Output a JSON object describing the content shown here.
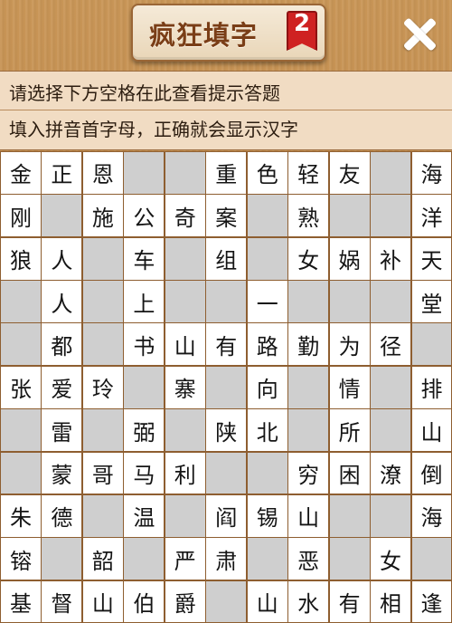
{
  "header": {
    "title": "疯狂填字",
    "badge": "2"
  },
  "hint": {
    "line1": "请选择下方空格在此查看提示答题",
    "line2": "填入拼音首字母，正确就会显示汉字"
  },
  "grid": {
    "rows": 11,
    "cols": 11,
    "cells": [
      [
        "金",
        "正",
        "恩",
        "#",
        "#",
        "重",
        "色",
        "轻",
        "友",
        "#",
        "海"
      ],
      [
        "刚",
        "#",
        "施",
        "公",
        "奇",
        "案",
        "#",
        "熟",
        "#",
        "#",
        "洋"
      ],
      [
        "狼",
        "人",
        "#",
        "车",
        "#",
        "组",
        "#",
        "女",
        "娲",
        "补",
        "天"
      ],
      [
        "#",
        "人",
        "#",
        "上",
        "#",
        "#",
        "一",
        "#",
        "#",
        "#",
        "堂"
      ],
      [
        "#",
        "都",
        "#",
        "书",
        "山",
        "有",
        "路",
        "勤",
        "为",
        "径",
        "#"
      ],
      [
        "张",
        "爱",
        "玲",
        "#",
        "寨",
        "#",
        "向",
        "#",
        "情",
        "#",
        "排"
      ],
      [
        "#",
        "雷",
        "#",
        "弼",
        "#",
        "陕",
        "北",
        "#",
        "所",
        "#",
        "山"
      ],
      [
        "#",
        "蒙",
        "哥",
        "马",
        "利",
        "#",
        "#",
        "穷",
        "困",
        "潦",
        "倒"
      ],
      [
        "朱",
        "德",
        "#",
        "温",
        "#",
        "阎",
        "锡",
        "山",
        "#",
        "#",
        "海"
      ],
      [
        "镕",
        "#",
        "韶",
        "#",
        "严",
        "肃",
        "#",
        "恶",
        "#",
        "女",
        "#"
      ],
      [
        "基",
        "督",
        "山",
        "伯",
        "爵",
        "#",
        "山",
        "水",
        "有",
        "相",
        "逢"
      ]
    ]
  }
}
